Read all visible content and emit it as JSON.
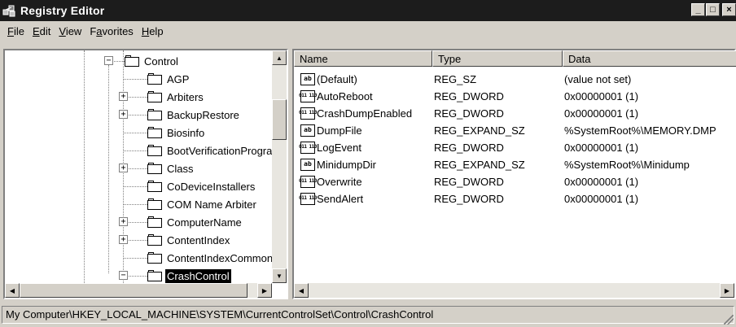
{
  "window": {
    "title": "Registry Editor",
    "minimize": "_",
    "maximize": "□",
    "close": "×"
  },
  "menu": [
    {
      "label": "File"
    },
    {
      "label": "Edit"
    },
    {
      "label": "View"
    },
    {
      "label": "Favorites"
    },
    {
      "label": "Help"
    }
  ],
  "tree": {
    "items": [
      {
        "label": "Control",
        "expander": "−"
      },
      {
        "label": "AGP",
        "expander": ""
      },
      {
        "label": "Arbiters",
        "expander": "+"
      },
      {
        "label": "BackupRestore",
        "expander": "+"
      },
      {
        "label": "Biosinfo",
        "expander": ""
      },
      {
        "label": "BootVerificationProgram",
        "expander": ""
      },
      {
        "label": "Class",
        "expander": "+"
      },
      {
        "label": "CoDeviceInstallers",
        "expander": ""
      },
      {
        "label": "COM Name Arbiter",
        "expander": ""
      },
      {
        "label": "ComputerName",
        "expander": "+"
      },
      {
        "label": "ContentIndex",
        "expander": "+"
      },
      {
        "label": "ContentIndexCommon",
        "expander": ""
      },
      {
        "label": "CrashControl",
        "expander": "−",
        "selected": true
      }
    ]
  },
  "list": {
    "columns": [
      "Name",
      "Type",
      "Data"
    ],
    "rows": [
      {
        "icon": "ab",
        "name": "(Default)",
        "type": "REG_SZ",
        "data": "(value not set)"
      },
      {
        "icon": "bin",
        "name": "AutoReboot",
        "type": "REG_DWORD",
        "data": "0x00000001 (1)"
      },
      {
        "icon": "bin",
        "name": "CrashDumpEnabled",
        "type": "REG_DWORD",
        "data": "0x00000001 (1)"
      },
      {
        "icon": "ab",
        "name": "DumpFile",
        "type": "REG_EXPAND_SZ",
        "data": "%SystemRoot%\\MEMORY.DMP"
      },
      {
        "icon": "bin",
        "name": "LogEvent",
        "type": "REG_DWORD",
        "data": "0x00000001 (1)"
      },
      {
        "icon": "ab",
        "name": "MinidumpDir",
        "type": "REG_EXPAND_SZ",
        "data": "%SystemRoot%\\Minidump"
      },
      {
        "icon": "bin",
        "name": "Overwrite",
        "type": "REG_DWORD",
        "data": "0x00000001 (1)"
      },
      {
        "icon": "bin",
        "name": "SendAlert",
        "type": "REG_DWORD",
        "data": "0x00000001 (1)"
      }
    ]
  },
  "status": {
    "path": "My Computer\\HKEY_LOCAL_MACHINE\\SYSTEM\\CurrentControlSet\\Control\\CrashControl"
  },
  "icons": {
    "string_value": "ab",
    "binary_value": "011 110",
    "scroll_up": "▲",
    "scroll_down": "▼",
    "scroll_left": "◀",
    "scroll_right": "▶"
  },
  "colors": {
    "titlebar": "#1c1c1c",
    "selection": "#000000",
    "face": "#d4d0c8"
  }
}
